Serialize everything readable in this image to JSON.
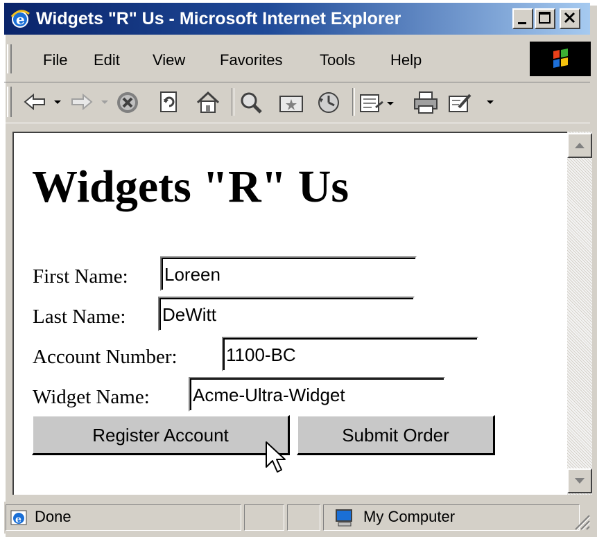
{
  "window": {
    "title": "Widgets \"R\" Us - Microsoft Internet Explorer",
    "controls": [
      "minimize-icon",
      "maximize-icon",
      "close-icon"
    ]
  },
  "menu": {
    "items": [
      "File",
      "Edit",
      "View",
      "Favorites",
      "Tools",
      "Help"
    ]
  },
  "toolbar": {
    "icons": [
      "back-icon",
      "forward-icon",
      "stop-icon",
      "refresh-icon",
      "home-icon",
      "search-icon",
      "favorites-icon",
      "history-icon",
      "mail-icon",
      "print-icon",
      "edit-icon"
    ]
  },
  "page": {
    "heading": "Widgets \"R\" Us",
    "fields": [
      {
        "label": "First Name:",
        "value": "Loreen"
      },
      {
        "label": "Last Name:",
        "value": "DeWitt"
      },
      {
        "label": "Account Number:",
        "value": "1100-BC"
      },
      {
        "label": "Widget Name:",
        "value": "Acme-Ultra-Widget"
      }
    ],
    "buttons": {
      "register": "Register Account",
      "submit": "Submit Order"
    }
  },
  "status": {
    "text": "Done",
    "zone": "My Computer"
  },
  "colors": {
    "titlebar_start": "#0a246a",
    "titlebar_end": "#a6caf0",
    "chrome": "#d4d0c8"
  }
}
